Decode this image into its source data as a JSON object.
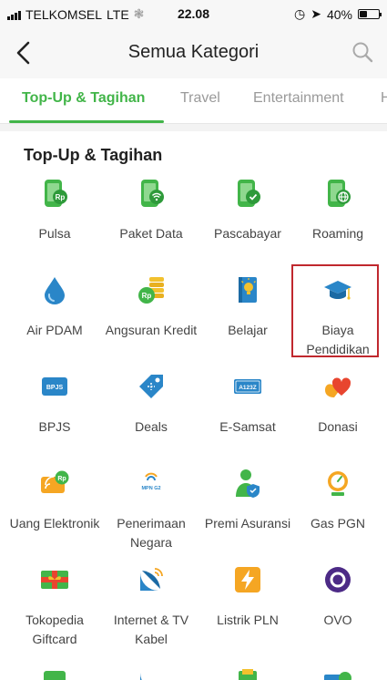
{
  "status_bar": {
    "carrier": "TELKOMSEL",
    "network": "LTE",
    "time": "22.08",
    "battery": "40%",
    "battery_level": 0.4
  },
  "header": {
    "title": "Semua Kategori",
    "back_icon": "chevron-left-icon",
    "search_icon": "search-icon"
  },
  "tabs": [
    {
      "label": "Top-Up & Tagihan",
      "active": true
    },
    {
      "label": "Travel",
      "active": false
    },
    {
      "label": "Entertainment",
      "active": false
    },
    {
      "label": "H",
      "active": false
    }
  ],
  "section": {
    "title": "Top-Up & Tagihan"
  },
  "categories": [
    {
      "label": "Pulsa",
      "icon": "phone-rp-icon"
    },
    {
      "label": "Paket Data",
      "icon": "phone-wifi-icon"
    },
    {
      "label": "Pascabayar",
      "icon": "phone-check-icon"
    },
    {
      "label": "Roaming",
      "icon": "phone-globe-icon"
    },
    {
      "label": "Air PDAM",
      "icon": "water-drop-icon"
    },
    {
      "label": "Angsuran Kredit",
      "icon": "coin-stack-icon"
    },
    {
      "label": "Belajar",
      "icon": "book-bulb-icon"
    },
    {
      "label": "Biaya Pendidikan",
      "icon": "graduation-cap-icon"
    },
    {
      "label": "BPJS",
      "icon": "bpjs-card-icon"
    },
    {
      "label": "Deals",
      "icon": "price-tag-icon"
    },
    {
      "label": "E-Samsat",
      "icon": "license-plate-icon"
    },
    {
      "label": "Donasi",
      "icon": "heart-hand-icon"
    },
    {
      "label": "Uang Elektronik",
      "icon": "e-money-card-icon"
    },
    {
      "label": "Penerimaan Negara",
      "icon": "mpn-icon"
    },
    {
      "label": "Premi Asuransi",
      "icon": "person-shield-icon"
    },
    {
      "label": "Gas PGN",
      "icon": "gas-gauge-icon"
    },
    {
      "label": "Tokopedia Giftcard",
      "icon": "giftcard-icon"
    },
    {
      "label": "Internet & TV Kabel",
      "icon": "satellite-icon"
    },
    {
      "label": "Listrik PLN",
      "icon": "lightning-icon"
    },
    {
      "label": "OVO",
      "icon": "ovo-icon"
    }
  ],
  "colors": {
    "accent": "#42b549",
    "highlight": "#c0282e"
  }
}
